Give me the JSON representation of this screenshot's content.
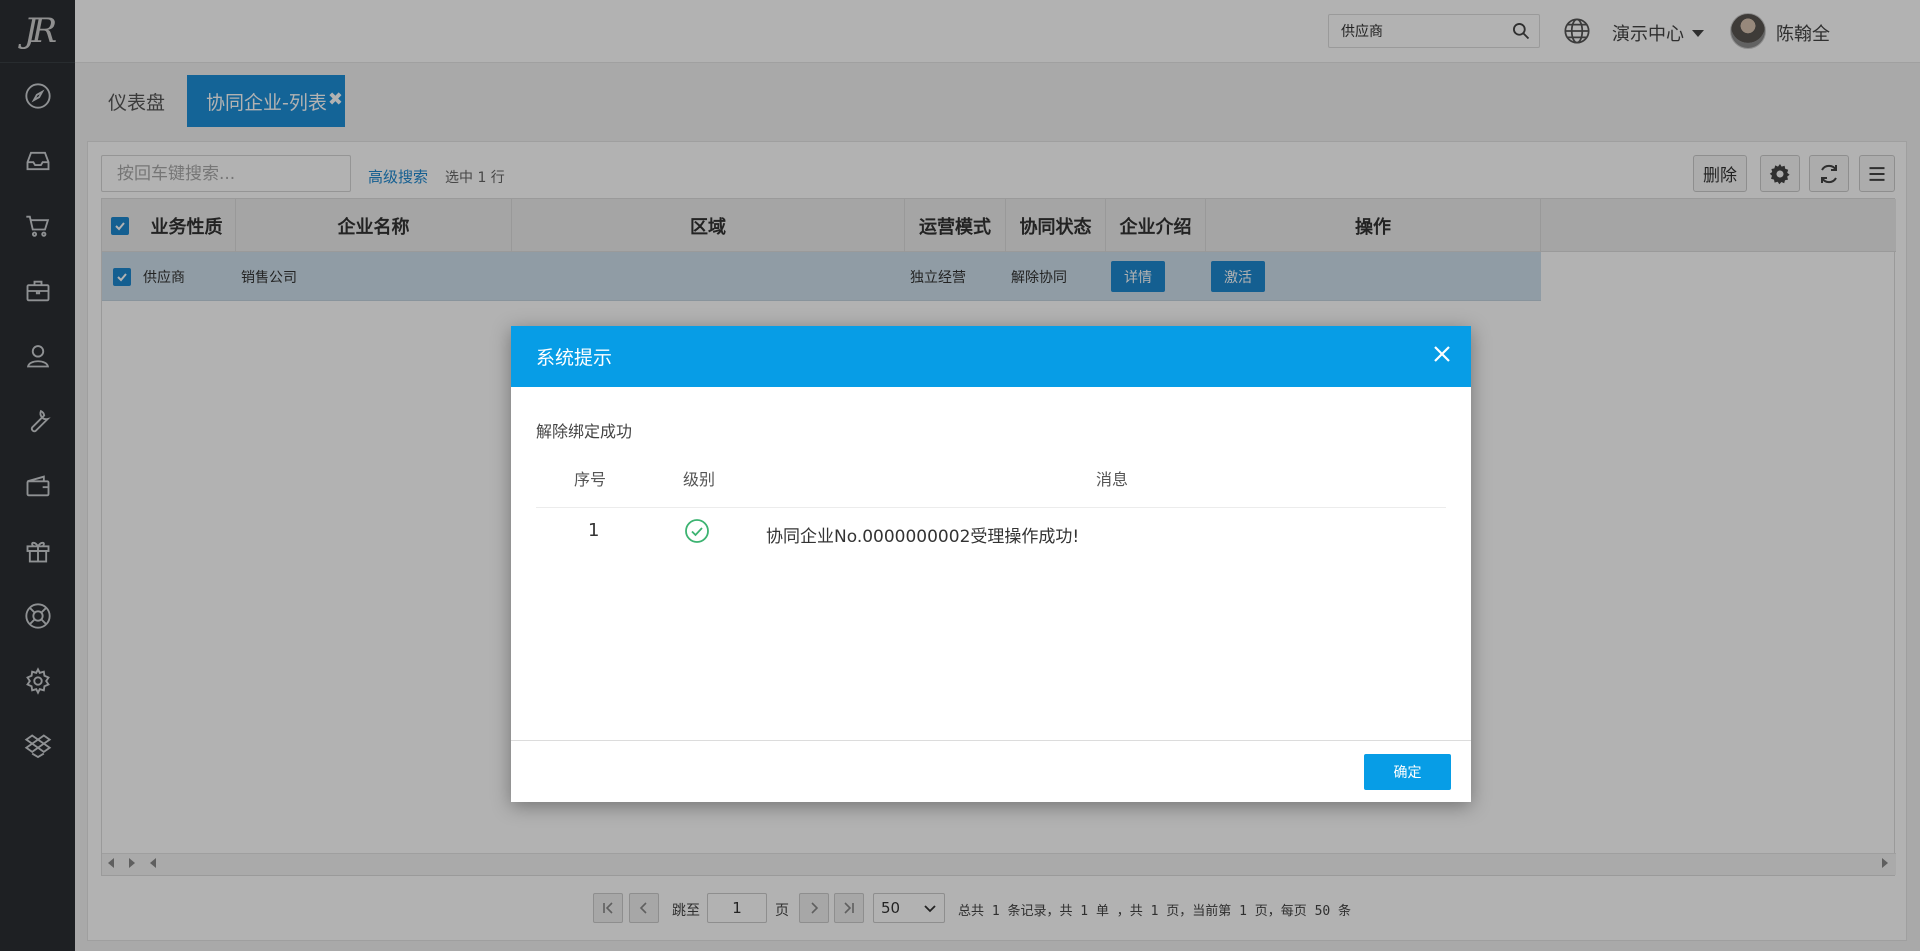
{
  "sidebar": {
    "logo_text": "JR",
    "items": [
      {
        "icon": "compass-icon"
      },
      {
        "icon": "inbox-icon"
      },
      {
        "icon": "cart-icon"
      },
      {
        "icon": "briefcase-icon"
      },
      {
        "icon": "user-icon"
      },
      {
        "icon": "wrench-icon"
      },
      {
        "icon": "wallet-icon"
      },
      {
        "icon": "gift-icon"
      },
      {
        "icon": "lifebuoy-icon"
      },
      {
        "icon": "gear-icon"
      },
      {
        "icon": "dropbox-icon"
      }
    ]
  },
  "topbar": {
    "search_value": "供应商",
    "workspace": "演示中心",
    "user_name": "陈翰全",
    "help_symbol": "?"
  },
  "tabs": [
    {
      "label": "仪表盘"
    },
    {
      "label": "协同企业-列表",
      "close": "✖"
    }
  ],
  "toolbar": {
    "search_placeholder": "按回车键搜索...",
    "advanced_search": "高级搜索",
    "selection_info": "选中 1 行",
    "delete_label": "删除"
  },
  "grid": {
    "columns": [
      "业务性质",
      "企业名称",
      "区域",
      "运营模式",
      "协同状态",
      "企业介绍",
      "操作"
    ],
    "rows": [
      {
        "checked": true,
        "business_type": "供应商",
        "company_name": "销售公司",
        "region": "",
        "operation_mode": "独立经营",
        "coop_status": "解除协同",
        "detail_button": "详情",
        "activate_button": "激活"
      }
    ]
  },
  "pager": {
    "jump_to": "跳至",
    "page_value": "1",
    "page_unit": "页",
    "page_size": "50",
    "summary": "总共 1 条记录，共 1 单 ，共 1 页，当前第 1 页，每页 50 条"
  },
  "dialog": {
    "title": "系统提示",
    "message": "解除绑定成功",
    "headers": [
      "序号",
      "级别",
      "消息"
    ],
    "rows": [
      {
        "index": "1",
        "level_icon": "success-check-icon",
        "text": "协同企业No.0000000002受理操作成功!"
      }
    ],
    "ok_label": "确定"
  },
  "colors": {
    "primary": "#079de6",
    "tab_active": "#1e90d8",
    "sidebar_bg": "#2b2f33",
    "selected_row": "#cfe0ec",
    "success": "#3cb371"
  }
}
